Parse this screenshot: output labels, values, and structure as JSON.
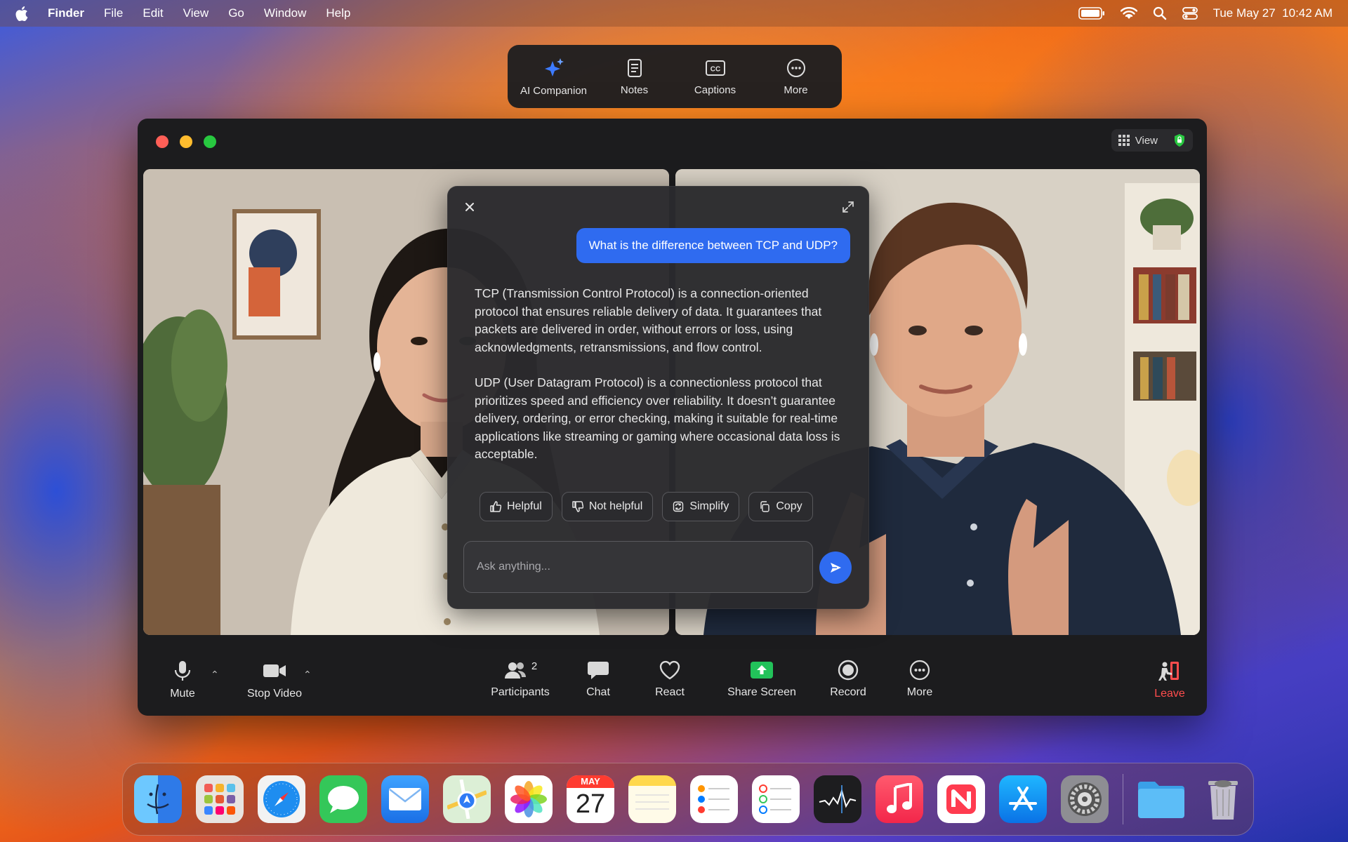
{
  "menubar": {
    "app": "Finder",
    "items": [
      "File",
      "Edit",
      "View",
      "Go",
      "Window",
      "Help"
    ],
    "datetime": "Tue May 27  10:42 AM"
  },
  "float_toolbar": {
    "items": [
      {
        "label": "AI Companion",
        "icon": "sparkle-icon"
      },
      {
        "label": "Notes",
        "icon": "notes-icon"
      },
      {
        "label": "Captions",
        "icon": "captions-icon"
      },
      {
        "label": "More",
        "icon": "more-icon"
      }
    ]
  },
  "window": {
    "view_label": "View"
  },
  "ai_panel": {
    "question": "What is the difference between TCP and UDP?",
    "answer": [
      "TCP (Transmission Control Protocol) is a connection-oriented protocol that ensures reliable delivery of data. It guarantees that packets are delivered in order, without errors or loss, using acknowledgments, retransmissions, and flow control.",
      "UDP (User Datagram Protocol) is a connectionless protocol that prioritizes speed and efficiency over reliability. It doesn’t guarantee delivery, ordering, or error checking, making it suitable for real-time applications like streaming or gaming where occasional data loss is acceptable."
    ],
    "actions": [
      "Helpful",
      "Not helpful",
      "Simplify",
      "Copy"
    ],
    "placeholder": "Ask anything..."
  },
  "controls": {
    "mute": "Mute",
    "stop_video": "Stop Video",
    "participants": "Participants",
    "participants_count": "2",
    "chat": "Chat",
    "react": "React",
    "share": "Share Screen",
    "record": "Record",
    "more": "More",
    "leave": "Leave"
  },
  "dock": {
    "calendar_month": "MAY",
    "calendar_day": "27"
  },
  "colors": {
    "accent_blue": "#2f6bf0",
    "share_green": "#22c25a",
    "leave_red": "#ff4d4d"
  }
}
